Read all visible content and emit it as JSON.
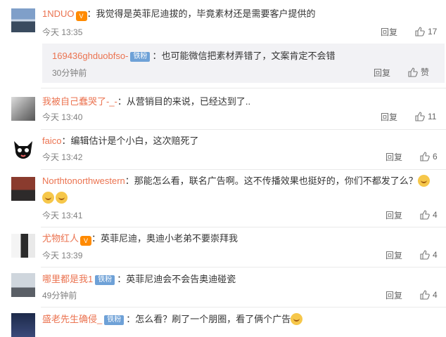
{
  "ui": {
    "reply_label": "回复",
    "praise_label": "赞"
  },
  "comments": [
    {
      "name": "1NDUO",
      "text": "：我觉得是英菲尼迪拔的，毕竟素材还是需要客户提供的",
      "time": "今天 13:35",
      "likes": "17"
    },
    {
      "name": "169436ghduobfso-",
      "badge": "铁粉",
      "text": "：也可能微信把素材弄错了，文案肯定不会错",
      "time": "30分钟前"
    },
    {
      "name": "我被自己蠢哭了-_-",
      "text": "：从营销目的来说，已经达到了..",
      "time": "今天 13:40",
      "likes": "11"
    },
    {
      "name": "faico",
      "text": "：编辑估计是个小白，这次赔死了",
      "time": "今天 13:42",
      "likes": "6"
    },
    {
      "name": "Northtonorthwestern",
      "text": "：那能怎么看，联名广告啊。这不传播效果也挺好的，你们不都发了么？",
      "time": "今天 13:41",
      "likes": "4"
    },
    {
      "name": "尤物红人",
      "text": "：英菲尼迪，奥迪小老弟不要崇拜我",
      "time": "今天 13:39",
      "likes": "4"
    },
    {
      "name": "哪里都是我1",
      "badge": "铁粉",
      "text": "：英菲尼迪会不会告奥迪碰瓷",
      "time": "49分钟前",
      "likes": "4"
    },
    {
      "name": "盛老先生确侵_",
      "badge": "铁粉",
      "text": "：怎么看？刷了一个朋圈，看了俩个广告"
    }
  ],
  "colors": {
    "name": "#eb7350",
    "badge": "#6ea1d7",
    "time": "#808080"
  }
}
